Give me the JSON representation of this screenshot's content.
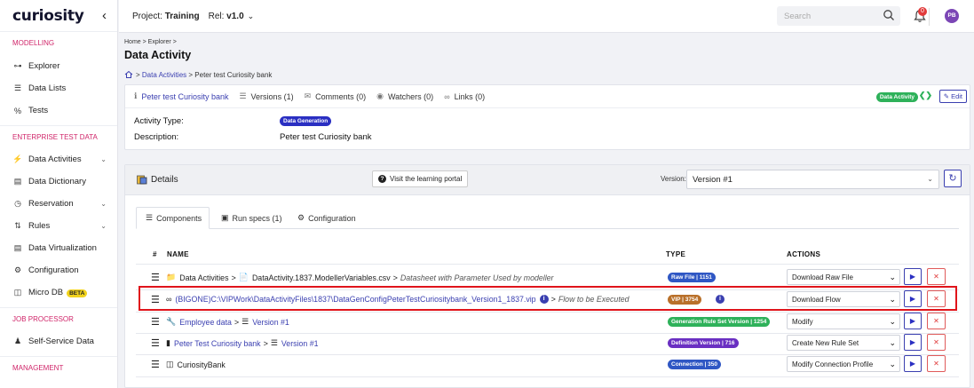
{
  "app": {
    "logo": "curiosity"
  },
  "sidebar": {
    "sections": [
      {
        "title": "MODELLING",
        "items": [
          {
            "label": "Explorer",
            "icon": "explorer-icon"
          },
          {
            "label": "Data Lists",
            "icon": "list-icon"
          },
          {
            "label": "Tests",
            "icon": "tests-icon"
          }
        ]
      },
      {
        "title": "ENTERPRISE TEST DATA",
        "items": [
          {
            "label": "Data Activities",
            "icon": "bolt-icon"
          },
          {
            "label": "Data Dictionary",
            "icon": "dictionary-icon"
          },
          {
            "label": "Reservation",
            "icon": "reservation-icon"
          },
          {
            "label": "Rules",
            "icon": "rules-icon"
          },
          {
            "label": "Data Virtualization",
            "icon": "virtualization-icon"
          },
          {
            "label": "Configuration",
            "icon": "gear-icon"
          },
          {
            "label": "Micro DB",
            "icon": "database-icon",
            "badge": "BETA"
          }
        ]
      },
      {
        "title": "JOB PROCESSOR",
        "items": [
          {
            "label": "Self-Service Data",
            "icon": "user-gear-icon"
          }
        ]
      },
      {
        "title": "MANAGEMENT",
        "items": []
      }
    ]
  },
  "topbar": {
    "project_label": "Project:",
    "project_value": "Training",
    "rel_label": "Rel:",
    "rel_value": "v1.0",
    "search_placeholder": "Search",
    "notification_count": "0",
    "avatar_initials": "PB"
  },
  "header": {
    "breadcrumb": [
      "Home",
      "Explorer"
    ],
    "title": "Data Activity",
    "sub_breadcrumb": [
      "Data Activities",
      "Peter test Curiosity bank"
    ]
  },
  "activity": {
    "meta": [
      {
        "label": "Peter test Curiosity bank",
        "icon": "info-icon"
      },
      {
        "label": "Versions (1)",
        "icon": "layers-icon"
      },
      {
        "label": "Comments (0)",
        "icon": "comments-icon"
      },
      {
        "label": "Watchers (0)",
        "icon": "eye-icon"
      },
      {
        "label": "Links (0)",
        "icon": "link-icon"
      }
    ],
    "type_badge": "Data Activity",
    "edit_label": "Edit",
    "activity_type_label": "Activity Type:",
    "activity_type_value": "Data Generation",
    "description_label": "Description:",
    "description_value": "Peter test Curiosity bank"
  },
  "details": {
    "title": "Details",
    "learn_button": "Visit the learning portal",
    "version_label": "Version:",
    "version_value": "Version #1",
    "tabs": [
      {
        "label": "Components",
        "icon": "list-icon",
        "active": true
      },
      {
        "label": "Run specs (1)",
        "icon": "run-icon",
        "active": false
      },
      {
        "label": "Configuration",
        "icon": "gear-icon",
        "active": false
      }
    ],
    "columns": {
      "hash": "#",
      "name": "NAME",
      "type": "TYPE",
      "actions": "ACTIONS"
    },
    "rows": [
      {
        "parts": [
          "Data Activities",
          "DataActivity.1837.ModellerVariables.csv"
        ],
        "note": "Datasheet with Parameter Used by modeller",
        "type": "Raw File | 1151",
        "type_color": "#2f57c4",
        "action": "Download Raw File"
      },
      {
        "parts": [
          "(BIGONE)C:\\VIPWork\\DataActivityFiles\\1837\\DataGenConfigPeterTestCuriositybank_Version1_1837.vip"
        ],
        "note": "Flow to be Executed",
        "type": "VIP | 3754",
        "type_color": "#b9702a",
        "action": "Download Flow",
        "highlighted": true
      },
      {
        "parts": [
          "Employee data",
          "Version #1"
        ],
        "note": "",
        "type": "Generation Rule Set Version | 1254",
        "type_color": "#2eb15a",
        "action": "Modify"
      },
      {
        "parts": [
          "Peter Test Curiosity bank",
          "Version #1"
        ],
        "note": "",
        "type": "Definition Version | 716",
        "type_color": "#6a2fc2",
        "action": "Create New Rule Set"
      },
      {
        "parts": [
          "CuriosityBank"
        ],
        "note": "",
        "type": "Connection | 350",
        "type_color": "#2f57c4",
        "action": "Modify Connection Profile"
      }
    ]
  },
  "colors": {
    "accent": "#3a3fb0",
    "section": "#d0266a",
    "highlight": "#e0141b"
  }
}
